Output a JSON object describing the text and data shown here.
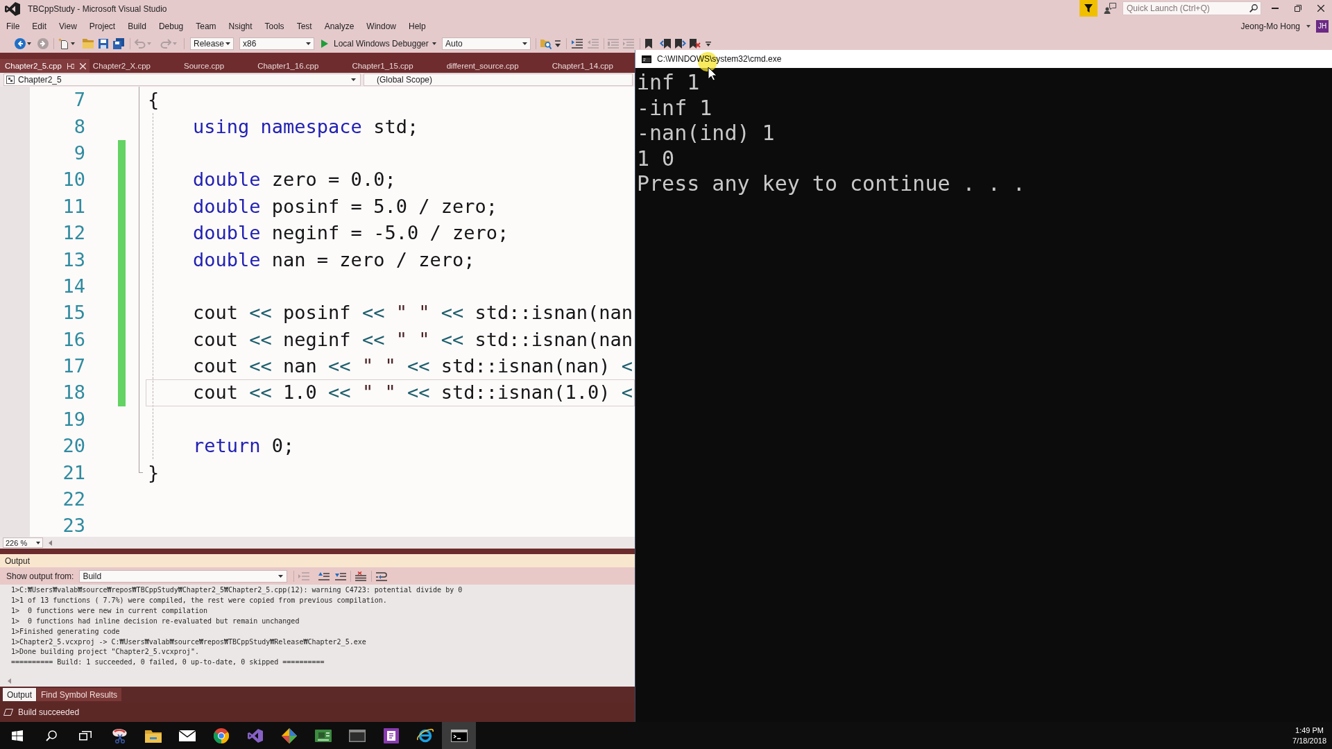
{
  "title_bar": {
    "title": "TBCppStudy - Microsoft Visual Studio",
    "menu": [
      "File",
      "Edit",
      "View",
      "Project",
      "Build",
      "Debug",
      "Team",
      "Nsight",
      "Tools",
      "Test",
      "Analyze",
      "Window",
      "Help"
    ],
    "quick_launch": {
      "placeholder": "Quick Launch (Ctrl+Q)"
    },
    "account": {
      "name": "Jeong-Mo Hong",
      "initials": "JH"
    }
  },
  "toolbar": {
    "left_buttons": [
      {
        "kind": "back",
        "disabled": false
      },
      {
        "kind": "forward",
        "disabled": true
      },
      {
        "kind": "new-project",
        "disabled": false
      },
      {
        "kind": "open",
        "disabled": false
      },
      {
        "kind": "save",
        "disabled": false
      },
      {
        "kind": "save-all",
        "disabled": false
      },
      {
        "kind": "undo",
        "disabled": true
      },
      {
        "kind": "redo",
        "disabled": true
      }
    ],
    "configuration": "Release",
    "platform": "x86",
    "debugger": "Local Windows Debugger",
    "debugger_type": "Auto",
    "right_buttons": [
      {
        "kind": "find-in-files",
        "disabled": false
      },
      {
        "kind": "options",
        "disabled": false
      },
      {
        "kind": "indent",
        "disabled": false
      },
      {
        "kind": "outdent",
        "disabled": true
      },
      {
        "kind": "comment",
        "disabled": true
      },
      {
        "kind": "uncomment",
        "disabled": true
      },
      {
        "kind": "bookmark",
        "disabled": false
      },
      {
        "kind": "previous-bookmark",
        "disabled": false
      },
      {
        "kind": "next-bookmark",
        "disabled": false
      },
      {
        "kind": "clear-bookmarks",
        "disabled": false
      },
      {
        "kind": "overflow",
        "disabled": false
      }
    ]
  },
  "tabs": [
    {
      "label": "Chapter2_5.cpp",
      "selected": true
    },
    {
      "label": "Chapter2_X.cpp",
      "selected": false
    },
    {
      "label": "Source.cpp",
      "selected": false
    },
    {
      "label": "Chapter1_16.cpp",
      "selected": false
    },
    {
      "label": "Chapter1_15.cpp",
      "selected": false
    },
    {
      "label": "different_source.cpp",
      "selected": false
    },
    {
      "label": "Chapter1_14.cpp",
      "selected": false
    }
  ],
  "navigation": {
    "project": "Chapter2_5",
    "scope": "(Global Scope)"
  },
  "editor": {
    "lines": [
      {
        "number": "7",
        "changed": false,
        "current": false,
        "tokens": [
          {
            "kind": "plain",
            "text": "{"
          }
        ]
      },
      {
        "number": "8",
        "changed": false,
        "current": false,
        "tokens": [
          {
            "kind": "keyword",
            "text": "    using namespace"
          },
          {
            "kind": "plain",
            "text": " std;"
          }
        ]
      },
      {
        "number": "9",
        "changed": true,
        "current": false
      },
      {
        "number": "10",
        "changed": true,
        "current": false,
        "tokens": [
          {
            "kind": "keyword",
            "text": "    double"
          },
          {
            "kind": "plain",
            "text": " zero = 0.0;"
          }
        ]
      },
      {
        "number": "11",
        "changed": true,
        "current": false,
        "tokens": [
          {
            "kind": "keyword",
            "text": "    double"
          },
          {
            "kind": "plain",
            "text": " posinf = 5.0 / zero;"
          }
        ]
      },
      {
        "number": "12",
        "changed": true,
        "current": false,
        "tokens": [
          {
            "kind": "keyword",
            "text": "    double"
          },
          {
            "kind": "plain",
            "text": " neginf = -5.0 / zero;"
          }
        ]
      },
      {
        "number": "13",
        "changed": true,
        "current": false,
        "tokens": [
          {
            "kind": "keyword",
            "text": "    double"
          },
          {
            "kind": "plain",
            "text": " nan = zero / zero;"
          }
        ]
      },
      {
        "number": "14",
        "changed": true,
        "current": false
      },
      {
        "number": "15",
        "changed": true,
        "current": false,
        "tokens": [
          {
            "kind": "plain",
            "text": "    cout "
          },
          {
            "kind": "operator",
            "text": "<<"
          },
          {
            "kind": "plain",
            "text": " posinf "
          },
          {
            "kind": "operator",
            "text": "<<"
          },
          {
            "kind": "string",
            "text": " \" \" "
          },
          {
            "kind": "operator",
            "text": "<<"
          },
          {
            "kind": "plain",
            "text": " std::isnan(nan"
          }
        ]
      },
      {
        "number": "16",
        "changed": true,
        "current": false,
        "tokens": [
          {
            "kind": "plain",
            "text": "    cout "
          },
          {
            "kind": "operator",
            "text": "<<"
          },
          {
            "kind": "plain",
            "text": " neginf "
          },
          {
            "kind": "operator",
            "text": "<<"
          },
          {
            "kind": "string",
            "text": " \" \" "
          },
          {
            "kind": "operator",
            "text": "<<"
          },
          {
            "kind": "plain",
            "text": " std::isnan(nan"
          }
        ]
      },
      {
        "number": "17",
        "changed": true,
        "current": false,
        "tokens": [
          {
            "kind": "plain",
            "text": "    cout "
          },
          {
            "kind": "operator",
            "text": "<<"
          },
          {
            "kind": "plain",
            "text": " nan "
          },
          {
            "kind": "operator",
            "text": "<<"
          },
          {
            "kind": "string",
            "text": " \" \" "
          },
          {
            "kind": "operator",
            "text": "<<"
          },
          {
            "kind": "plain",
            "text": " std::isnan(nan) "
          },
          {
            "kind": "operator",
            "text": "<"
          }
        ]
      },
      {
        "number": "18",
        "changed": true,
        "current": true,
        "tokens": [
          {
            "kind": "plain",
            "text": "    cout "
          },
          {
            "kind": "operator",
            "text": "<<"
          },
          {
            "kind": "plain",
            "text": " 1.0 "
          },
          {
            "kind": "operator",
            "text": "<<"
          },
          {
            "kind": "string",
            "text": " \" \" "
          },
          {
            "kind": "operator",
            "text": "<<"
          },
          {
            "kind": "plain",
            "text": " std::isnan(1.0) "
          },
          {
            "kind": "operator",
            "text": "<"
          }
        ]
      },
      {
        "number": "19",
        "changed": false,
        "current": false
      },
      {
        "number": "20",
        "changed": false,
        "current": false,
        "tokens": [
          {
            "kind": "keyword",
            "text": "    return"
          },
          {
            "kind": "plain",
            "text": " 0;"
          }
        ]
      },
      {
        "number": "21",
        "changed": false,
        "current": false,
        "tokens": [
          {
            "kind": "plain",
            "text": "}"
          }
        ]
      },
      {
        "number": "22",
        "changed": false,
        "current": false
      },
      {
        "number": "23",
        "changed": false,
        "current": false
      }
    ],
    "zoom": "226 %"
  },
  "output": {
    "title": "Output",
    "source_label": "Show output from:",
    "source": "Build",
    "tools": [
      {
        "kind": "go-to-current",
        "disabled": true
      },
      {
        "kind": "find-previous",
        "disabled": false
      },
      {
        "kind": "find-next",
        "disabled": false
      },
      {
        "kind": "clear-all",
        "disabled": false
      },
      {
        "kind": "word-wrap",
        "disabled": false
      }
    ],
    "lines": [
      "1>C:₩Users₩valab₩source₩repos₩TBCppStudy₩Chapter2_5₩Chapter2_5.cpp(12): warning C4723: potential divide by 0",
      "1>1 of 13 functions ( 7.7%) were compiled, the rest were copied from previous compilation.",
      "1>  0 functions were new in current compilation",
      "1>  0 functions had inline decision re-evaluated but remain unchanged",
      "1>Finished generating code",
      "1>Chapter2_5.vcxproj -> C:₩Users₩valab₩source₩repos₩TBCppStudy₩Release₩Chapter2_5.exe",
      "1>Done building project \"Chapter2_5.vcxproj\".",
      "========== Build: 1 succeeded, 0 failed, 0 up-to-date, 0 skipped =========="
    ]
  },
  "bottom_tabs": [
    {
      "label": "Output",
      "selected": true
    },
    {
      "label": "Find Symbol Results",
      "selected": false
    }
  ],
  "status_bar": {
    "text": "Build succeeded"
  },
  "console": {
    "title": "C:\\WINDOWS\\system32\\cmd.exe",
    "lines": [
      "inf 1",
      "-inf 1",
      "-nan(ind) 1",
      "1 0",
      "Press any key to continue . . ."
    ]
  },
  "taskbar": {
    "apps": [
      {
        "kind": "start",
        "selected": false
      },
      {
        "kind": "search",
        "selected": false
      },
      {
        "kind": "task-view",
        "selected": false
      },
      {
        "kind": "snip",
        "selected": false
      },
      {
        "kind": "folder",
        "selected": false
      },
      {
        "kind": "mail",
        "selected": false
      },
      {
        "kind": "browser",
        "selected": false
      },
      {
        "kind": "ide",
        "selected": false
      },
      {
        "kind": "diamond",
        "selected": false
      },
      {
        "kind": "board",
        "selected": false
      },
      {
        "kind": "window",
        "selected": false
      },
      {
        "kind": "notebook",
        "selected": false
      },
      {
        "kind": "web",
        "selected": false
      },
      {
        "kind": "terminal",
        "selected": true
      }
    ],
    "time": "1:49 PM",
    "date": "7/18/2018"
  }
}
